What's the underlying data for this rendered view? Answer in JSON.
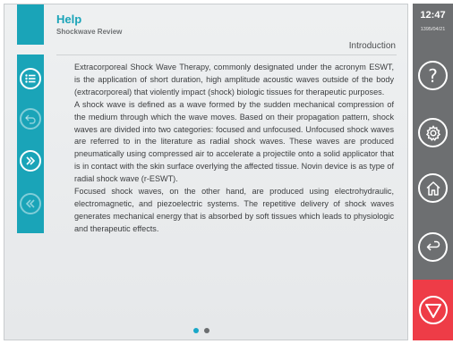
{
  "header": {
    "title": "Help",
    "subtitle": "Shockwave Review",
    "section": "Introduction"
  },
  "left_rail": {
    "items": [
      {
        "icon": "list-icon",
        "enabled": true
      },
      {
        "icon": "back-icon",
        "enabled": false
      },
      {
        "icon": "double-chevron-right-icon",
        "enabled": true
      },
      {
        "icon": "double-chevron-left-icon",
        "enabled": false
      }
    ]
  },
  "content": {
    "paragraphs": [
      "Extracorporeal Shock Wave Therapy, commonly designated under the acronym ESWT, is the application of short duration, high amplitude acoustic waves outside of the body (extracorporeal) that violently impact (shock) biologic tissues for therapeutic purposes.",
      "A shock wave is defined as a wave formed by the sudden mechanical compression of the medium through which the wave moves. Based on their propagation pattern, shock waves are divided into two categories: focused and unfocused. Unfocused shock waves are referred to in the literature as radial shock waves. These waves are produced pneumatically using compressed air to accelerate a projectile onto a solid applicator that is in contact with the skin surface overlying the affected tissue. Novin device is as type of radial shock wave (r-ESWT).",
      "Focused shock waves, on the other hand, are produced using electrohydraulic, electromagnetic, and piezoelectric systems. The repetitive delivery of shock waves generates mechanical energy that is absorbed by soft tissues which leads to physiologic and therapeutic effects."
    ]
  },
  "pager": {
    "pages": 2,
    "current": 1
  },
  "sidebar": {
    "time": "12:47",
    "date": "1395/04/21",
    "buttons": [
      {
        "icon": "help-icon",
        "label": "?"
      },
      {
        "icon": "gear-icon"
      },
      {
        "icon": "home-icon"
      },
      {
        "icon": "back-arrow-icon"
      },
      {
        "icon": "stop-icon"
      }
    ]
  },
  "colors": {
    "accent": "#1aa4b8",
    "sidebar": "#6d6f71",
    "stop": "#ee3c47",
    "pager_active": "#19a7c8"
  }
}
